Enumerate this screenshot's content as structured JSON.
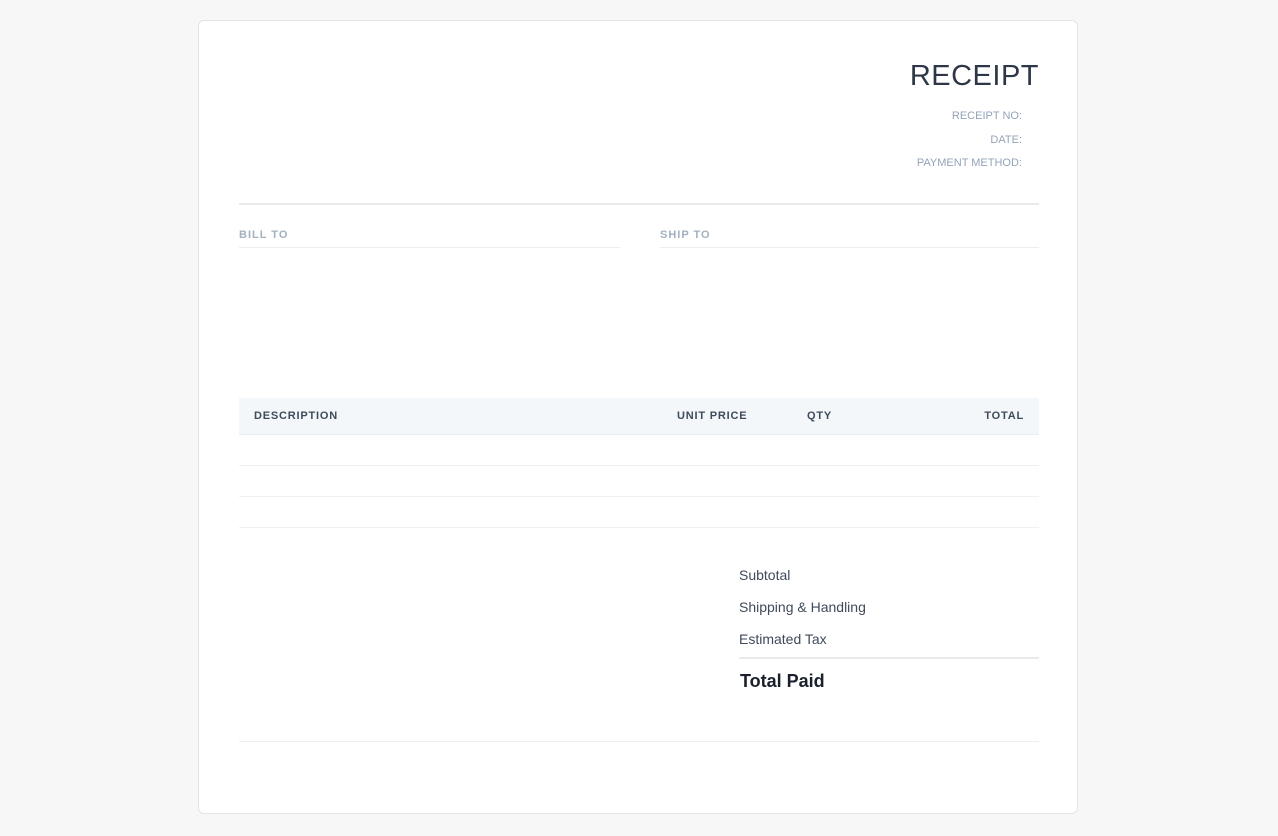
{
  "header": {
    "title": "RECEIPT",
    "meta_labels": [
      "RECEIPT NO:",
      "DATE:",
      "PAYMENT METHOD:"
    ]
  },
  "parties": {
    "bill_to_label": "BILL TO",
    "ship_to_label": "SHIP TO"
  },
  "table": {
    "columns": [
      "DESCRIPTION",
      "UNIT PRICE",
      "QTY",
      "TOTAL"
    ],
    "rows": [
      [],
      [],
      []
    ]
  },
  "totals": {
    "subtotal_label": "Subtotal",
    "shipping_label": "Shipping & Handling",
    "tax_label": "Estimated Tax",
    "grand_label": "Total Paid"
  }
}
